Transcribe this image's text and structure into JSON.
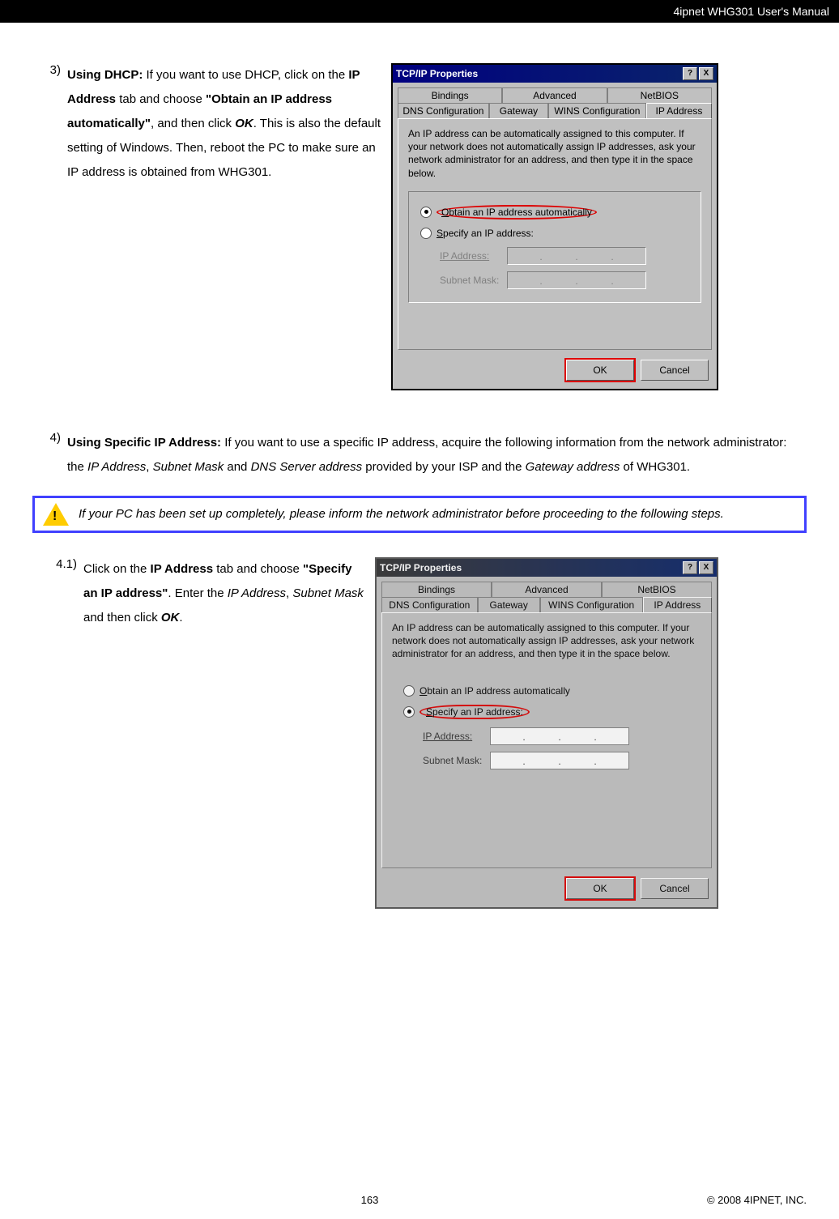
{
  "header": {
    "title": "4ipnet WHG301 User's Manual"
  },
  "steps": {
    "s3": {
      "num": "3)",
      "bold1": "Using DHCP:",
      "t1": " If you want to use DHCP, click on the ",
      "bold2": "IP Address",
      "t2": " tab and choose ",
      "bold3": "\"Obtain an IP address automatically\"",
      "t3": ", and then click ",
      "boldital1": "OK",
      "t4": ". This is also the default setting of Windows. Then, reboot the PC to make sure an IP address is obtained from WHG301."
    },
    "s4": {
      "num": "4)",
      "bold1": "Using Specific IP Address:",
      "t1": " If you want to use a specific IP address, acquire the following information from the network administrator: the ",
      "ital1": "IP Address",
      "t2": ", ",
      "ital2": "Subnet Mask",
      "t3": " and ",
      "ital3": "DNS Server address",
      "t4": " provided by your ISP and the ",
      "ital4": "Gateway address",
      "t5": " of WHG301."
    },
    "s41": {
      "num": "4.1)",
      "t1": "Click on the ",
      "bold1": "IP Address",
      "t2": " tab and choose ",
      "bold2": "\"Specify an IP address\"",
      "t3": ". Enter the ",
      "ital1": "IP Address",
      "t4": ", ",
      "ital2": "Subnet Mask",
      "t5": " and then click ",
      "boldital1": "OK",
      "t6": "."
    }
  },
  "notice": {
    "text": "If your PC has been set up completely, please inform the network administrator before proceeding to the following steps."
  },
  "dialog1": {
    "title": "TCP/IP Properties",
    "help": "?",
    "close": "X",
    "tabs_row1": [
      "Bindings",
      "Advanced",
      "NetBIOS"
    ],
    "tabs_row2": [
      "DNS Configuration",
      "Gateway",
      "WINS Configuration",
      "IP Address"
    ],
    "desc": "An IP address can be automatically assigned to this computer. If your network does not automatically assign IP addresses, ask your network administrator for an address, and then type it in the space below.",
    "radio1_pref": "O",
    "radio1_rest": "btain an IP address automatically",
    "radio2_pref": "S",
    "radio2_rest": "pecify an IP address:",
    "ip_label": "IP Address:",
    "mask_label": "Subnet Mask:",
    "ok": "OK",
    "cancel": "Cancel"
  },
  "dialog2": {
    "title": "TCP/IP Properties",
    "help": "?",
    "close": "X",
    "tabs_row1": [
      "Bindings",
      "Advanced",
      "NetBIOS"
    ],
    "tabs_row2": ": ",
    "tabs_r2": [
      "DNS Configuration",
      "Gateway",
      "WINS Configuration",
      "IP Address"
    ],
    "desc": "An IP address can be automatically assigned to this computer. If your network does not automatically assign IP addresses, ask your network administrator for an address, and then type it in the space below.",
    "radio1_pref": "O",
    "radio1_rest": "btain an IP address automatically",
    "radio2_pref": "S",
    "radio2_rest": "pecify an IP address:",
    "ip_label": "IP Address:",
    "mask_label": "Subnet Mask:",
    "ok": "OK",
    "cancel": "Cancel"
  },
  "footer": {
    "page": "163",
    "copyright": "© 2008 4IPNET, INC."
  }
}
